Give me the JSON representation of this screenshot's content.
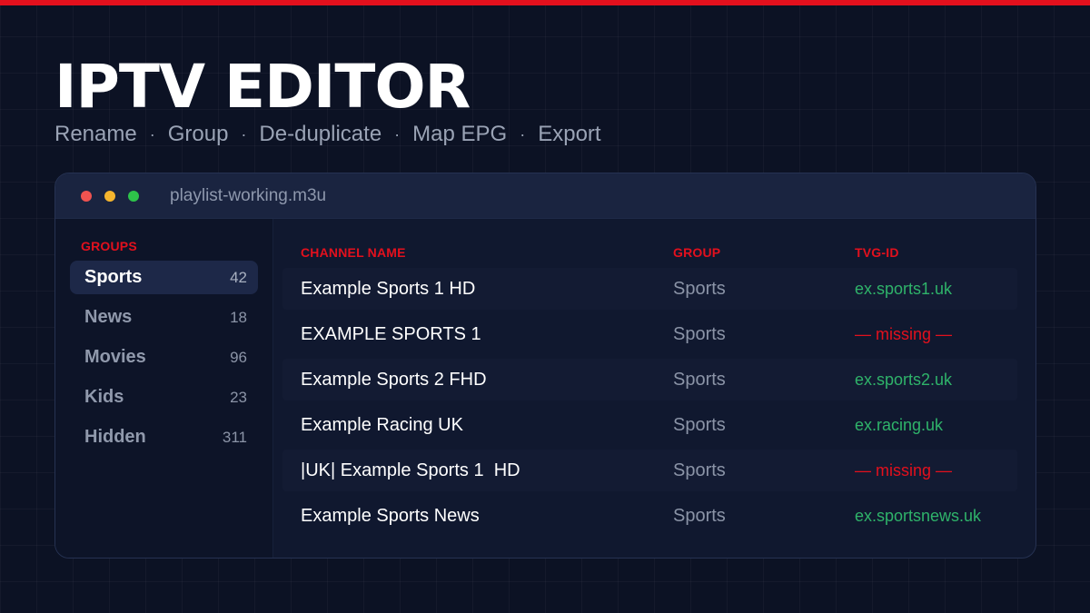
{
  "hero": {
    "title": "IPTV EDITOR",
    "features": [
      "Rename",
      "Group",
      "De-duplicate",
      "Map EPG",
      "Export"
    ],
    "separator": "·"
  },
  "colors": {
    "accent": "#e3101d",
    "ok": "#2fb36a",
    "background": "#0c1224"
  },
  "window": {
    "filename": "playlist-working.m3u"
  },
  "sidebar": {
    "heading": "GROUPS",
    "items": [
      {
        "label": "Sports",
        "count": "42",
        "active": true
      },
      {
        "label": "News",
        "count": "18",
        "active": false
      },
      {
        "label": "Movies",
        "count": "96",
        "active": false
      },
      {
        "label": "Kids",
        "count": "23",
        "active": false
      },
      {
        "label": "Hidden",
        "count": "311",
        "active": false
      }
    ]
  },
  "table": {
    "headers": {
      "name": "CHANNEL NAME",
      "group": "GROUP",
      "tvg": "TVG-ID"
    },
    "rows": [
      {
        "name": "Example Sports 1 HD",
        "group": "Sports",
        "tvg": "ex.sports1.uk",
        "status": "ok"
      },
      {
        "name": "EXAMPLE SPORTS 1",
        "group": "Sports",
        "tvg": "— missing —",
        "status": "missing"
      },
      {
        "name": "Example Sports 2 FHD",
        "group": "Sports",
        "tvg": "ex.sports2.uk",
        "status": "ok"
      },
      {
        "name": "Example Racing UK",
        "group": "Sports",
        "tvg": "ex.racing.uk",
        "status": "ok"
      },
      {
        "name": "|UK| Example Sports 1  HD",
        "group": "Sports",
        "tvg": "— missing —",
        "status": "missing"
      },
      {
        "name": "Example Sports News",
        "group": "Sports",
        "tvg": "ex.sportsnews.uk",
        "status": "ok"
      }
    ]
  }
}
